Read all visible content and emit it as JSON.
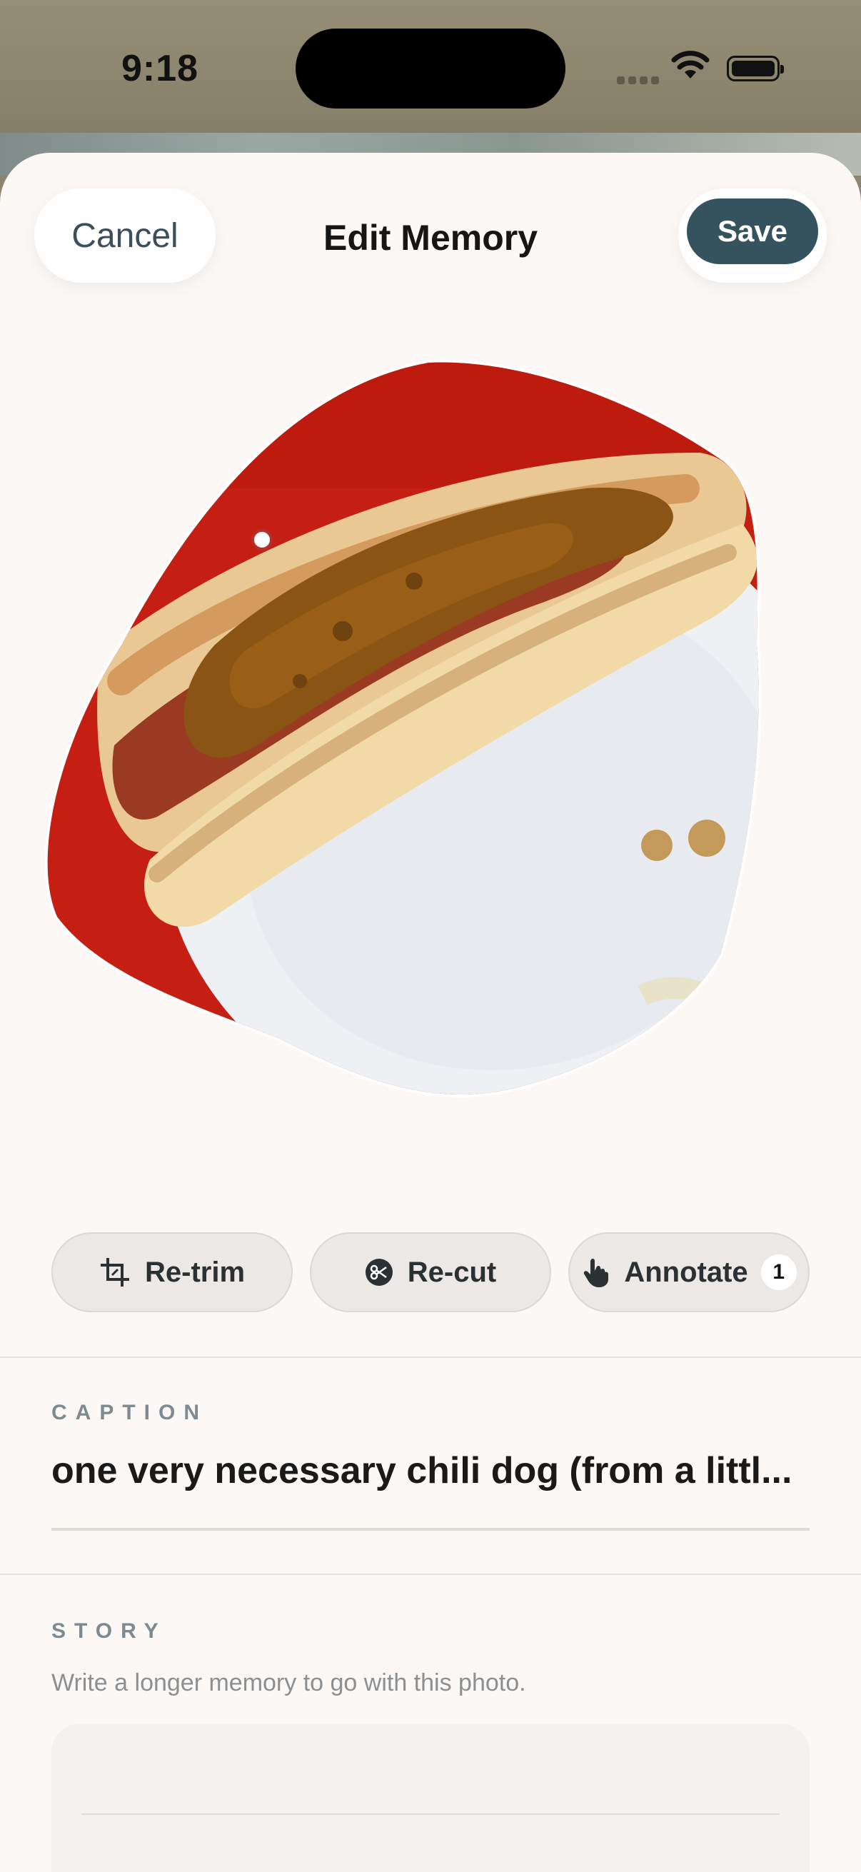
{
  "status": {
    "time": "9:18"
  },
  "nav": {
    "cancel": "Cancel",
    "title": "Edit Memory",
    "save": "Save"
  },
  "photo": {
    "subject": "chili dog on paper plate, cut-out shape"
  },
  "actions": [
    {
      "label": "Re-trim",
      "icon": "crop-icon"
    },
    {
      "label": "Re-cut",
      "icon": "scissors-icon"
    },
    {
      "label": "Annotate",
      "icon": "hand-pointer-icon",
      "badge": "1"
    }
  ],
  "caption": {
    "label": "CAPTION",
    "value": "one very necessary chili dog (from a littl..."
  },
  "story": {
    "label": "STORY",
    "hint": "Write a longer memory to go with this photo."
  }
}
